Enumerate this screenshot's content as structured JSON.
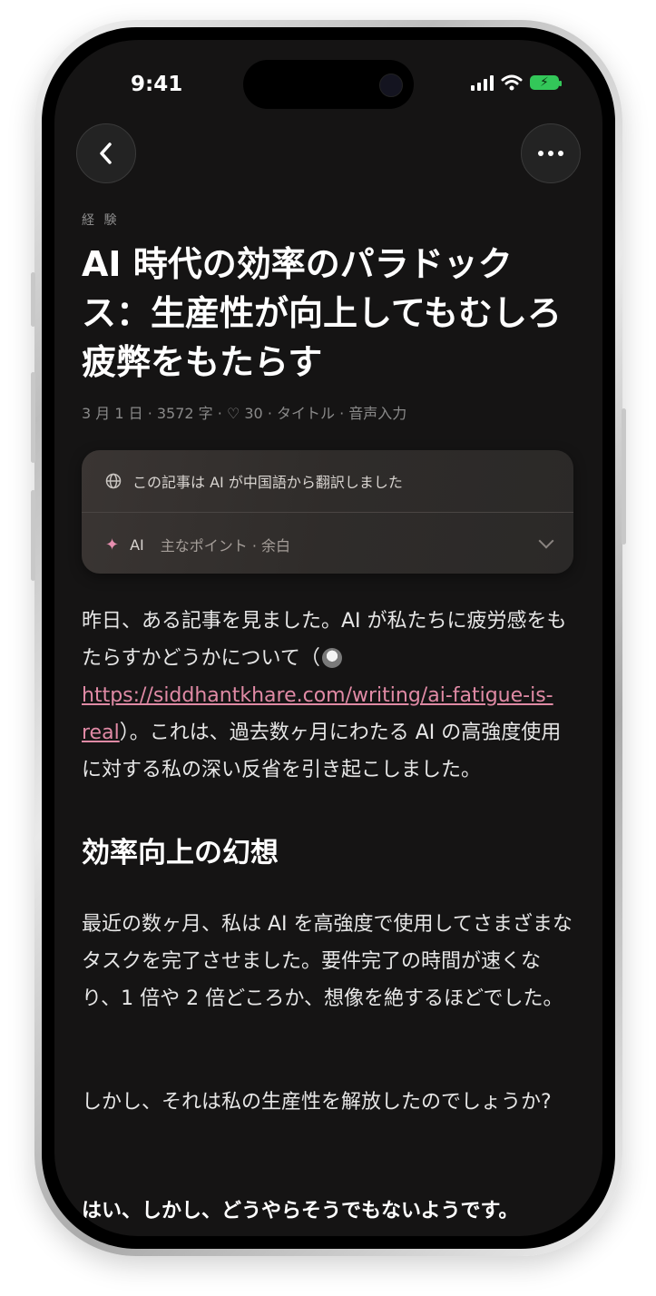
{
  "status": {
    "time": "9:41"
  },
  "nav": {
    "back_icon": "chevron-left-icon",
    "more_icon": "ellipsis-icon"
  },
  "article": {
    "category": "経 験",
    "title": "AI 時代の効率のパラドックス：生産性が向上してもむしろ疲弊をもたらす",
    "meta": "3 月 1 日 · 3572 字 · ♡ 30 · タイトル · 音声入力"
  },
  "ai_card": {
    "translation_note": "この記事は AI が中国語から翻訳しました",
    "ai_label": "AI",
    "points_label": "主なポイント · 余白"
  },
  "content": {
    "p1_before": "昨日、ある記事を見ました。AI が私たちに疲労感をもたらすかどうかについて（",
    "p1_link": "https://siddhantkhare.com/writing/ai-fatigue-is-real",
    "p1_after": "）。これは、過去数ヶ月にわたる AI の高強度使用に対する私の深い反省を引き起こしました。",
    "heading": "効率向上の幻想",
    "p2": "最近の数ヶ月、私は AI を高強度で使用してさまざまなタスクを完了させました。要件完了の時間が速くなり、1 倍や 2 倍どころか、想像を絶するほどでした。",
    "p3": "しかし、それは私の生産性を解放したのでしょうか?",
    "p4": "はい、しかし、どうやらそうでもないようです。"
  },
  "colors": {
    "background": "#151414",
    "link": "#e08aa5",
    "accent": "#e88fb0",
    "battery": "#33c759"
  }
}
